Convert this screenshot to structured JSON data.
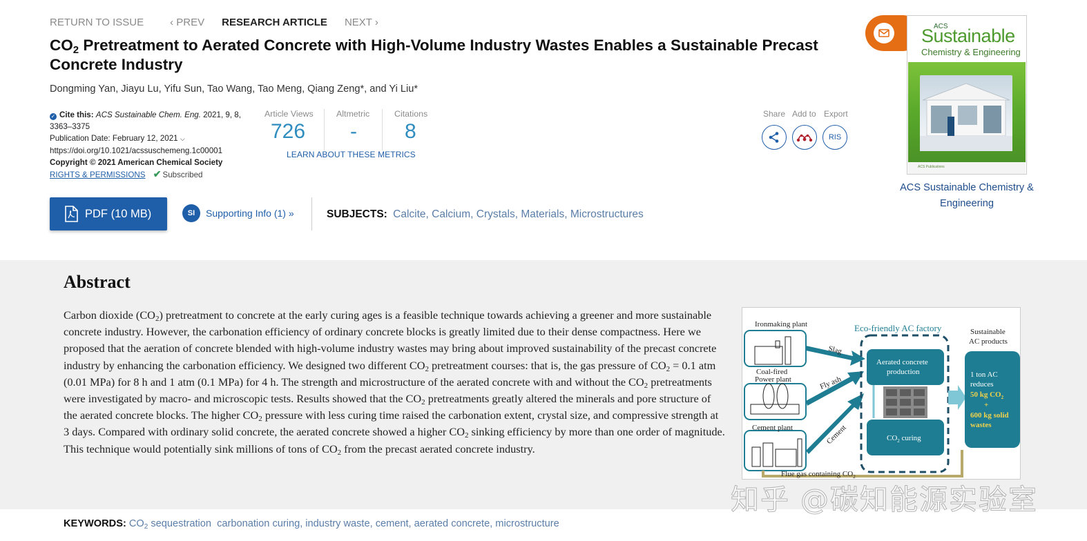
{
  "nav": {
    "return": "RETURN TO ISSUE",
    "prev": "‹ PREV",
    "current": "RESEARCH ARTICLE",
    "next": "NEXT ›"
  },
  "article": {
    "title_pre": "CO",
    "title_sub": "2",
    "title_post": " Pretreatment to Aerated Concrete with High-Volume Industry Wastes Enables a Sustainable Precast Concrete Industry",
    "authors": "Dongming Yan, Jiayu Lu, Yifu Sun, Tao Wang, Tao Meng, Qiang Zeng*, and Yi Liu*"
  },
  "cite": {
    "label": "Cite this:",
    "journal": "ACS Sustainable Chem. Eng.",
    "ref": " 2021, 9, 8, 3363–3375",
    "pub_date": "Publication Date: February 12, 2021",
    "doi": "https://doi.org/10.1021/acssuschemeng.1c00001",
    "copyright": "Copyright © 2021 American Chemical Society",
    "rights": "RIGHTS & PERMISSIONS",
    "subscribed": "Subscribed"
  },
  "metrics": {
    "views_label": "Article Views",
    "views": "726",
    "altmetric_label": "Altmetric",
    "altmetric": "-",
    "citations_label": "Citations",
    "citations": "8",
    "learn": "LEARN ABOUT THESE METRICS"
  },
  "tools": {
    "share": "Share",
    "add": "Add to",
    "export": "Export",
    "ris": "RIS"
  },
  "journal_cover": {
    "acs": "ACS",
    "name_big": "Sustainable",
    "name_small": "Chemistry & Engineering",
    "footer": "ACS Publications",
    "caption": "ACS Sustainable Chemistry & Engineering"
  },
  "actions": {
    "pdf": "PDF (10 MB)",
    "si_badge": "SI",
    "supporting": "Supporting Info (1) »",
    "subjects_label": "SUBJECTS:",
    "subjects": "Calcite, Calcium, Crystals, Materials, Microstructures"
  },
  "abstract": {
    "heading": "Abstract",
    "p1": "Carbon dioxide (CO",
    "p1b": ") pretreatment to concrete at the early curing ages is a feasible technique towards achieving a greener and more sustainable concrete industry. However, the carbonation efficiency of ordinary concrete blocks is greatly limited due to their dense compactness. Here we proposed that the aeration of concrete blended with high-volume industry wastes may bring about improved sustainability of the precast concrete industry by enhancing the carbonation efficiency. We designed two different CO",
    "p2": " pretreatment courses: that is, the gas pressure of CO",
    "p3": " = 0.1 atm (0.01 MPa) for 8 h and 1 atm (0.1 MPa) for 4 h. The strength and microstructure of the aerated concrete with and without the CO",
    "p4": " pretreatments were investigated by macro- and microscopic tests. Results showed that the CO",
    "p5": " pretreatments greatly altered the minerals and pore structure of the aerated concrete blocks. The higher CO",
    "p6": " pressure with less curing time raised the carbonation extent, crystal size, and compressive strength at 3 days. Compared with ordinary solid concrete, the aerated concrete showed a higher CO",
    "p7": " sinking efficiency by more than one order of magnitude. This technique would potentially sink millions of tons of CO",
    "p8": " from the precast aerated concrete industry.",
    "sub": "2"
  },
  "toc": {
    "ironmaking": "Ironmaking plant",
    "coalfired1": "Coal-fired",
    "coalfired2": "Power plant",
    "cement_plant": "Cement plant",
    "factory": "Eco-friendly AC factory",
    "slag": "Slag",
    "flyash": "Fly ash",
    "cement": "Cement",
    "aerated1": "Aerated concrete",
    "aerated2": "production",
    "curing": "CO",
    "curing2": " curing",
    "flue": "Flue gas containing CO",
    "sust1": "Sustainable",
    "sust2": "AC products",
    "ton1": "1 ton AC",
    "ton2": "reduces",
    "kg1": "50 kg CO",
    "plus": "+",
    "kg2": "600 kg solid",
    "wastes": "wastes",
    "sub2": "2"
  },
  "keywords": {
    "label": "KEYWORDS:",
    "k1": "CO",
    "k1sub": "2",
    "k1b": " sequestration",
    "rest": "  carbonation curing, industry waste, cement, aerated concrete, microstructure"
  },
  "watermark": "知乎 @碳知能源实验室",
  "colors": {
    "link": "#1f5ea8",
    "metric": "#2f8dc0",
    "mail": "#e56d14",
    "toc_teal": "#1e7d92"
  }
}
